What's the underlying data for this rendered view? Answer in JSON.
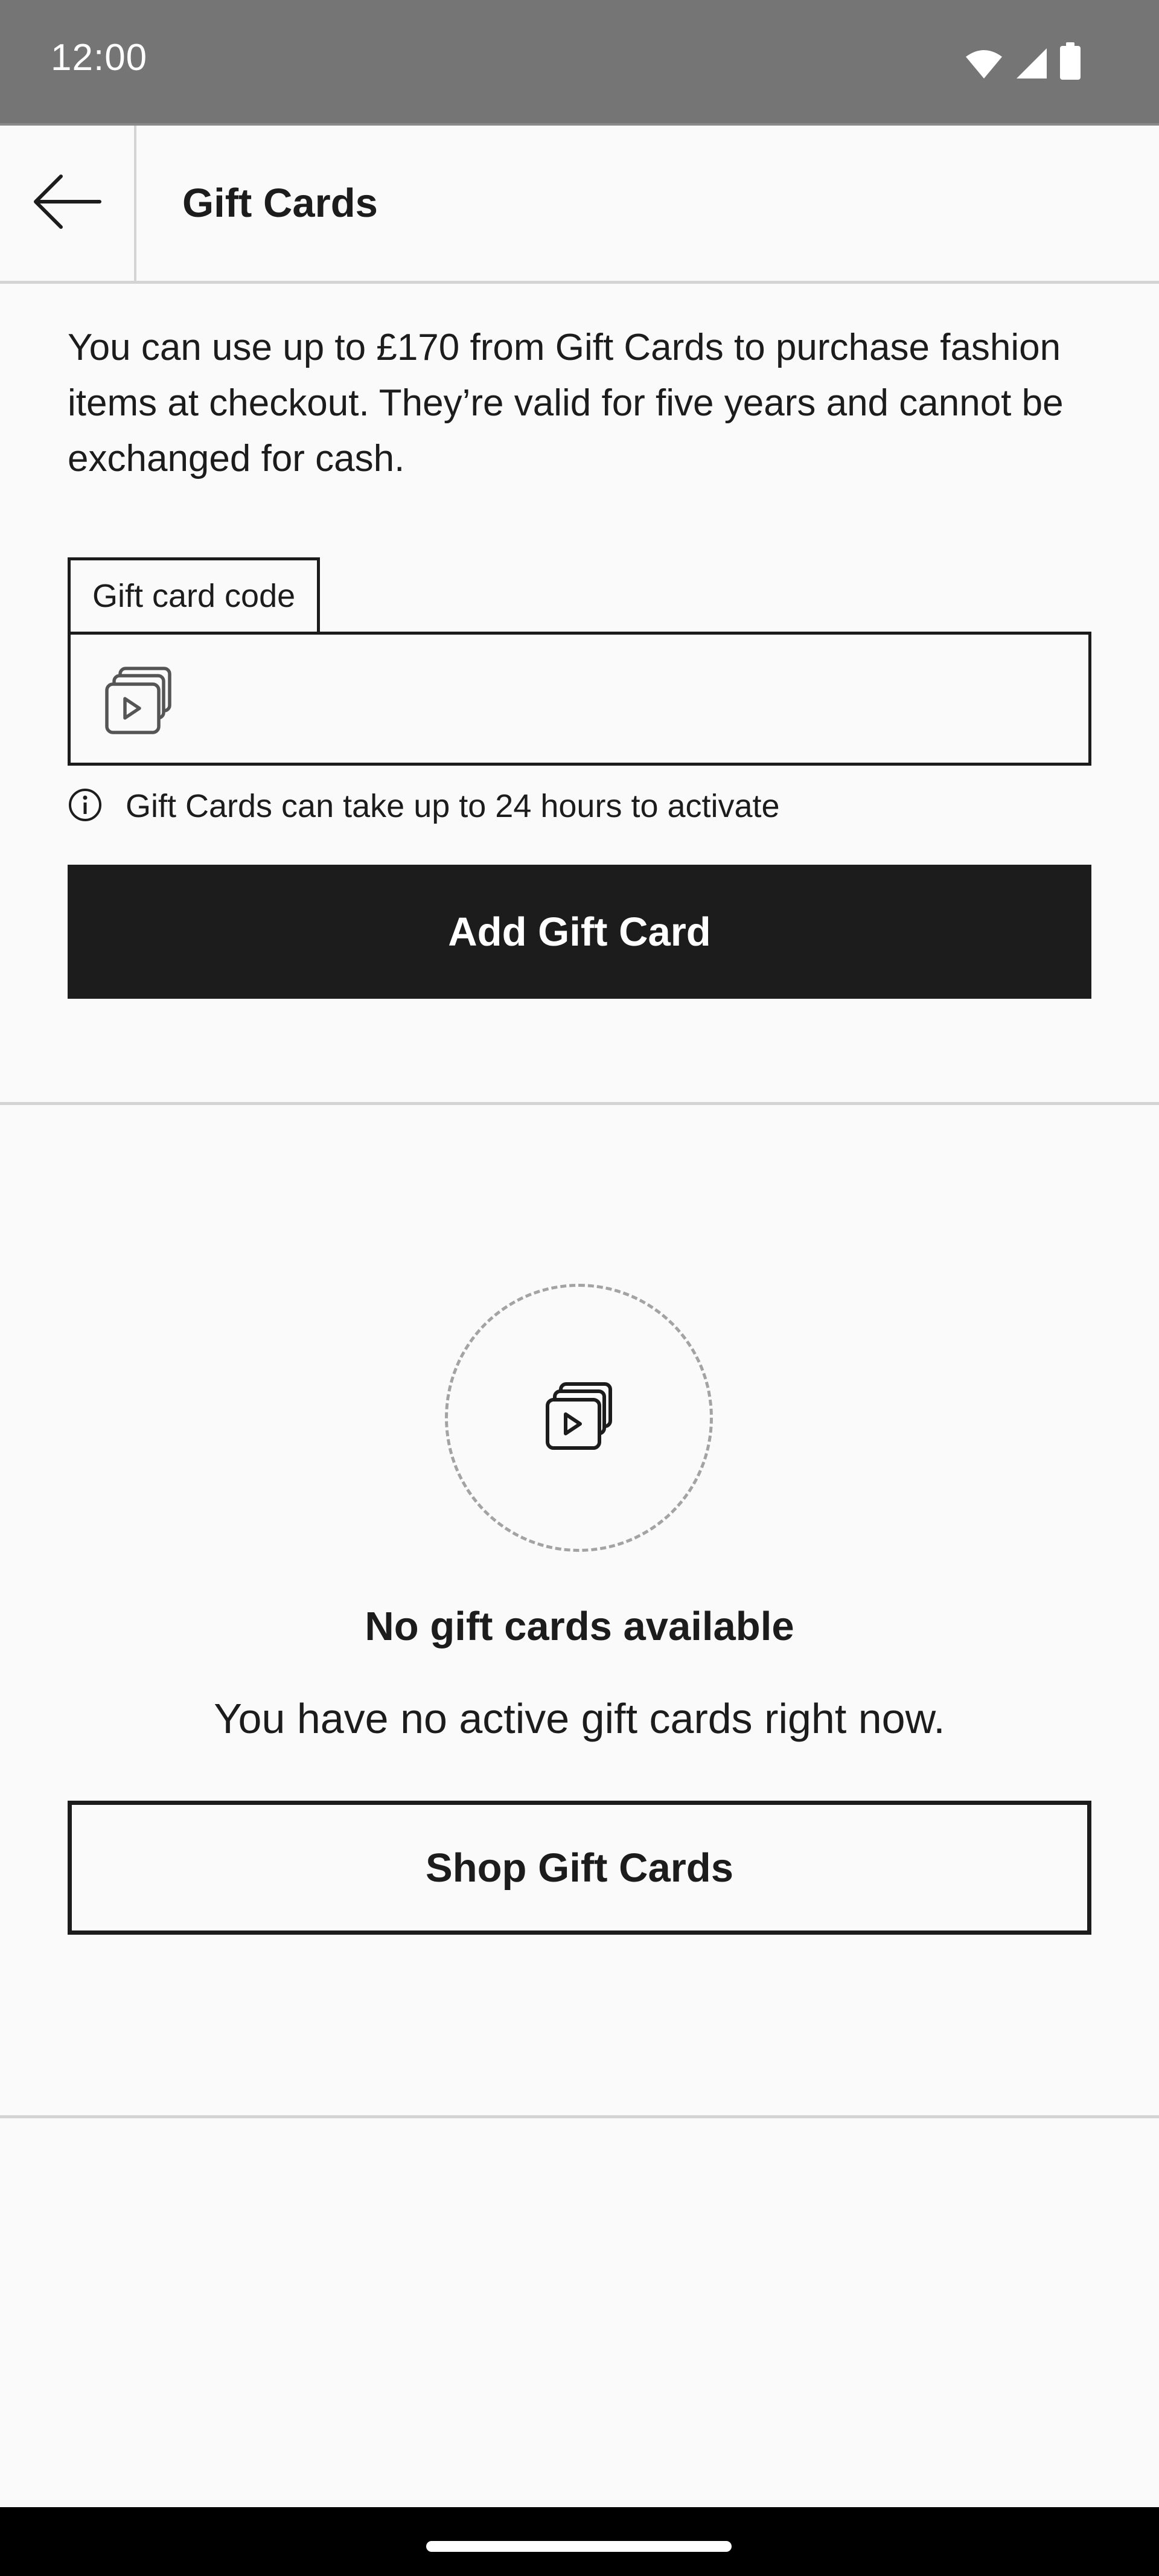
{
  "status_bar": {
    "time": "12:00",
    "icons": [
      "wifi-icon",
      "cellular-signal-icon",
      "battery-icon"
    ],
    "background": "#757575"
  },
  "app_bar": {
    "back_icon": "arrow-left-icon",
    "title": "Gift Cards"
  },
  "add_section": {
    "intro": "You can use up to £170 from Gift Cards to purchase fashion items at checkout. They’re valid for five years and cannot be exchanged for cash.",
    "code_field": {
      "label": "Gift card code",
      "value": "",
      "placeholder": "",
      "icon": "gift-card-icon"
    },
    "hint": {
      "icon": "info-icon",
      "text": "Gift Cards can take up to 24 hours to activate"
    },
    "add_button_label": "Add Gift Card"
  },
  "empty_state": {
    "icon": "gift-card-icon",
    "title": "No gift cards available",
    "subtitle": "You have no active gift cards right now.",
    "shop_button_label": "Shop Gift Cards"
  },
  "colors": {
    "primary": "#1c1c1c",
    "background": "#fafafa",
    "divider": "#d4d4d4",
    "nav_bar": "#000000"
  }
}
